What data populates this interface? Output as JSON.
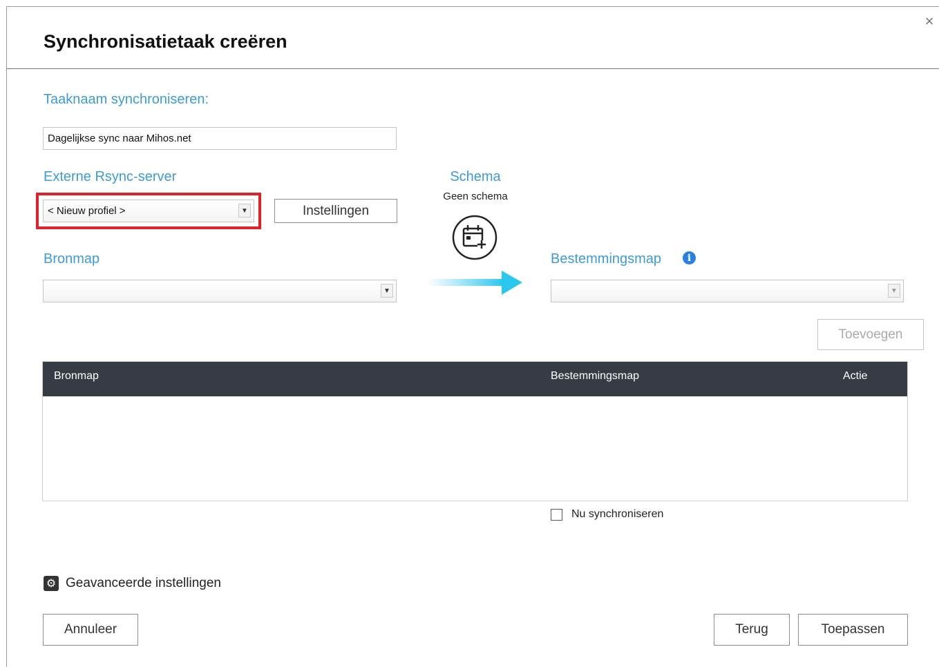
{
  "dialog": {
    "title": "Synchronisatietaak creëren",
    "close_glyph": "×"
  },
  "task_name": {
    "label": "Taaknaam synchroniseren:",
    "value": "Dagelijkse sync naar Mihos.net"
  },
  "rsync": {
    "label": "Externe Rsync-server",
    "selected": "< Nieuw profiel >",
    "settings_button": "Instellingen",
    "highlight_color": "#e2202a"
  },
  "schedule": {
    "label": "Schema",
    "value": "Geen schema",
    "icon": "calendar-add-icon"
  },
  "source": {
    "label": "Bronmap",
    "selected": ""
  },
  "destination": {
    "label": "Bestemmingsmap",
    "info_glyph": "i",
    "selected": ""
  },
  "add_button": "Toevoegen",
  "table": {
    "columns": [
      "Bronmap",
      "Bestemmingsmap",
      "Actie"
    ],
    "rows": []
  },
  "sync_now": {
    "label": "Nu synchroniseren",
    "checked": false
  },
  "advanced": {
    "label": "Geavanceerde instellingen",
    "icon": "gear-icon"
  },
  "footer": {
    "cancel": "Annuleer",
    "back": "Terug",
    "apply": "Toepassen"
  },
  "colors": {
    "accent_blue": "#3e9bd7",
    "table_header": "#373c44",
    "info_blue": "#2a7fe0"
  }
}
